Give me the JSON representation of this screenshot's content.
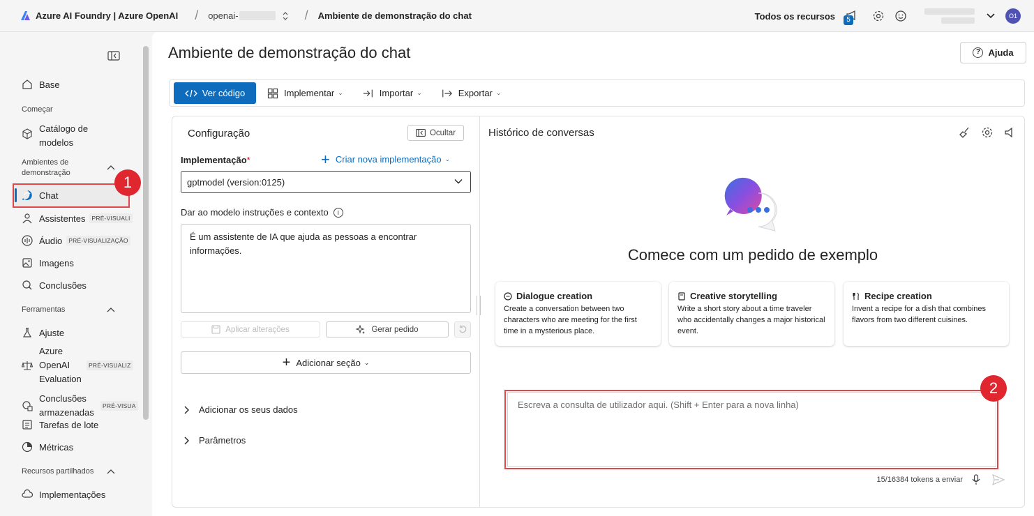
{
  "topbar": {
    "brand": "Azure AI Foundry | Azure OpenAI",
    "resource_prefix": "openai-",
    "page": "Ambiente de demonstração do chat",
    "all_resources": "Todos os recursos",
    "notification_count": "5",
    "avatar_initials": "O1"
  },
  "sidebar": {
    "items": [
      {
        "label": "Base",
        "icon": "home-icon"
      },
      {
        "label": "Catálogo de modelos",
        "icon": "cube-icon"
      },
      {
        "label": "Chat",
        "icon": "chat-icon"
      },
      {
        "label": "Assistentes",
        "tag": "PRÉ-VISUALI",
        "icon": "assistant-icon"
      },
      {
        "label": "Áudio",
        "tag": "PRÉ-VISUALIZAÇÃO",
        "icon": "audio-icon"
      },
      {
        "label": "Imagens",
        "icon": "image-icon"
      },
      {
        "label": "Conclusões",
        "icon": "completions-icon"
      },
      {
        "label": "Ajuste",
        "icon": "flask-icon"
      },
      {
        "label": "Azure OpenAI Evaluation",
        "tag": "PRÉ-VISUALIZ",
        "icon": "scale-icon"
      },
      {
        "label": "Conclusões armazenadas",
        "tag": "PRÉ-VISUA",
        "icon": "stored-icon"
      },
      {
        "label": "Tarefas de lote",
        "icon": "batch-icon"
      },
      {
        "label": "Métricas",
        "icon": "metrics-icon"
      },
      {
        "label": "Implementações",
        "icon": "cloud-icon"
      }
    ],
    "sections": {
      "start": "Começar",
      "playgrounds": "Ambientes de demonstração",
      "tools": "Ferramentas",
      "shared": "Recursos partilhados"
    },
    "markers": {
      "one": "1",
      "two": "2"
    }
  },
  "main": {
    "title": "Ambiente de demonstração do chat",
    "help": "Ajuda",
    "toolbar": {
      "view_code": "Ver código",
      "deploy": "Implementar",
      "import": "Importar",
      "export": "Exportar"
    }
  },
  "config": {
    "title": "Configuração",
    "hide": "Ocultar",
    "deployment_label": "Implementação",
    "required_mark": "*",
    "create_deployment": "Criar nova implementação",
    "deployment_value": "gptmodel (version:0125)",
    "instructions_label": "Dar ao modelo instruções e contexto",
    "instructions_value": "É um assistente de IA que ajuda as pessoas a encontrar informações.",
    "apply_changes": "Aplicar alterações",
    "generate_prompt": "Gerar pedido",
    "add_section": "Adicionar seção",
    "add_data": "Adicionar os seus dados",
    "parameters": "Parâmetros"
  },
  "chat": {
    "title": "Histórico de conversas",
    "hero_title": "Comece com um pedido de exemplo",
    "cards": [
      {
        "title": "Dialogue creation",
        "desc": "Create a conversation between two characters who are meeting for the first time in a mysterious place.",
        "icon": "chat-bubble-icon"
      },
      {
        "title": "Creative storytelling",
        "desc": "Write a short story about a time traveler who accidentally changes a major historical event.",
        "icon": "book-icon"
      },
      {
        "title": "Recipe creation",
        "desc": "Invent a recipe for a dish that combines flavors from two different cuisines.",
        "icon": "utensils-icon"
      }
    ],
    "input_placeholder": "Escreva a consulta de utilizador aqui. (Shift + Enter para a nova linha)",
    "tokens": "15/16384 tokens a enviar"
  },
  "colors": {
    "accent": "#0f6cbd",
    "highlight": "#e0474a",
    "marker": "#e0262f"
  }
}
